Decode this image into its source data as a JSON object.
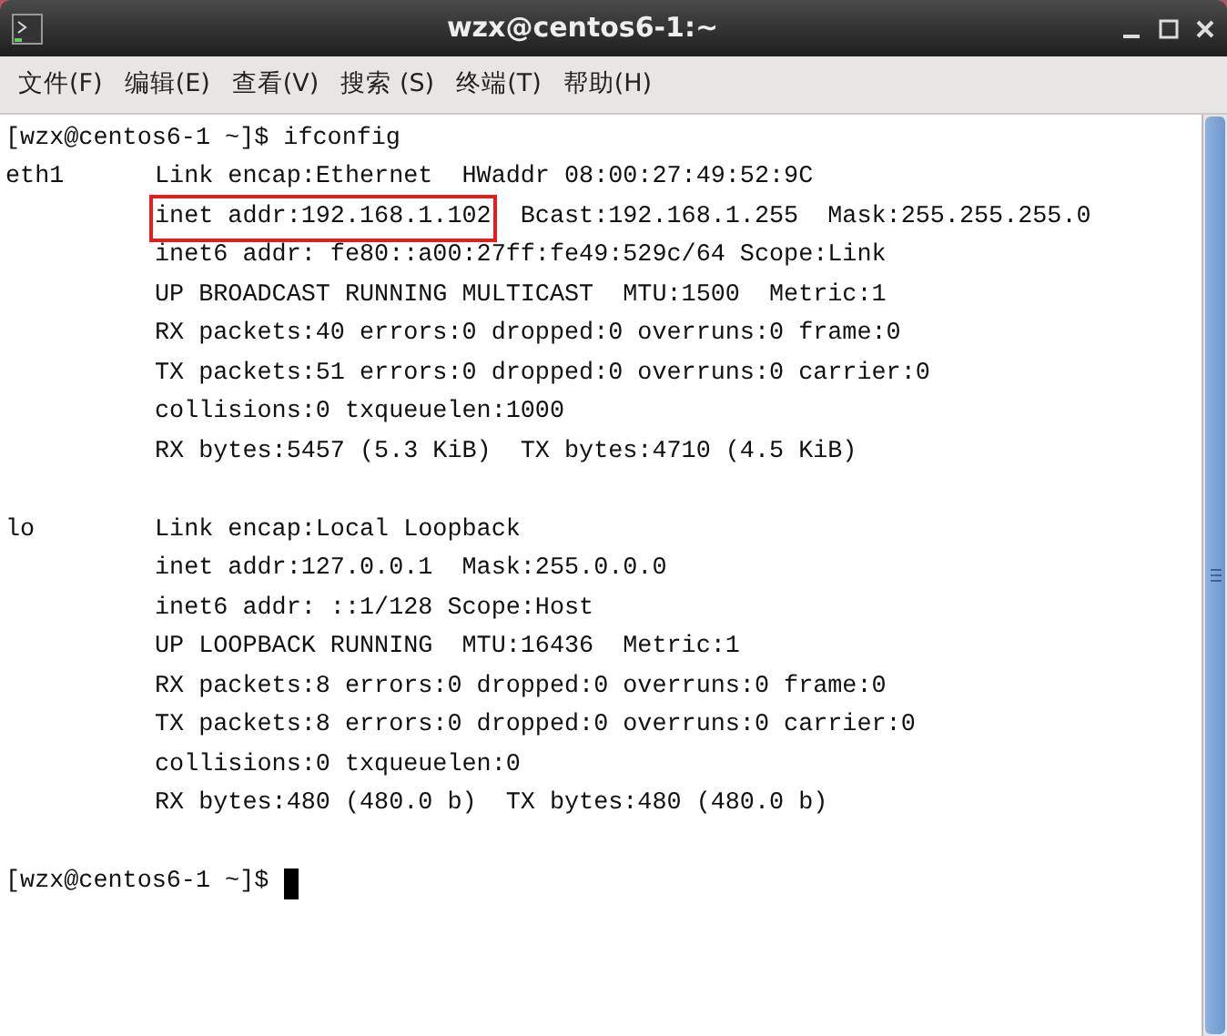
{
  "window": {
    "title": "wzx@centos6-1:~"
  },
  "menu": [
    "文件(F)",
    "编辑(E)",
    "查看(V)",
    "搜索 (S)",
    "终端(T)",
    "帮助(H)"
  ],
  "terminal": {
    "lines": [
      {
        "kind": "prompt",
        "text": "[wzx@centos6-1 ~]$ ifconfig",
        "cursor": false
      },
      {
        "kind": "field",
        "iface": "eth1",
        "parts": [
          {
            "text": "Link encap:Ethernet  HWaddr 08:00:27:49:52:9C",
            "highlighted": false
          }
        ]
      },
      {
        "kind": "field",
        "parts": [
          {
            "text": "inet addr:192.168.1.102",
            "highlighted": true
          },
          {
            "text": "  Bcast:192.168.1.255  Mask:255.255.255.0",
            "highlighted": false
          }
        ]
      },
      {
        "kind": "field",
        "parts": [
          {
            "text": "inet6 addr: fe80::a00:27ff:fe49:529c/64 Scope:Link",
            "highlighted": false
          }
        ]
      },
      {
        "kind": "field",
        "parts": [
          {
            "text": "UP BROADCAST RUNNING MULTICAST  MTU:1500  Metric:1",
            "highlighted": false
          }
        ]
      },
      {
        "kind": "field",
        "parts": [
          {
            "text": "RX packets:40 errors:0 dropped:0 overruns:0 frame:0",
            "highlighted": false
          }
        ]
      },
      {
        "kind": "field",
        "parts": [
          {
            "text": "TX packets:51 errors:0 dropped:0 overruns:0 carrier:0",
            "highlighted": false
          }
        ]
      },
      {
        "kind": "field",
        "parts": [
          {
            "text": "collisions:0 txqueuelen:1000",
            "highlighted": false
          }
        ]
      },
      {
        "kind": "field",
        "parts": [
          {
            "text": "RX bytes:5457 (5.3 KiB)  TX bytes:4710 (4.5 KiB)",
            "highlighted": false
          }
        ]
      },
      {
        "kind": "blank"
      },
      {
        "kind": "field",
        "iface": "lo",
        "parts": [
          {
            "text": "Link encap:Local Loopback",
            "highlighted": false
          }
        ]
      },
      {
        "kind": "field",
        "parts": [
          {
            "text": "inet addr:127.0.0.1  Mask:255.0.0.0",
            "highlighted": false
          }
        ]
      },
      {
        "kind": "field",
        "parts": [
          {
            "text": "inet6 addr: ::1/128 Scope:Host",
            "highlighted": false
          }
        ]
      },
      {
        "kind": "field",
        "parts": [
          {
            "text": "UP LOOPBACK RUNNING  MTU:16436  Metric:1",
            "highlighted": false
          }
        ]
      },
      {
        "kind": "field",
        "parts": [
          {
            "text": "RX packets:8 errors:0 dropped:0 overruns:0 frame:0",
            "highlighted": false
          }
        ]
      },
      {
        "kind": "field",
        "parts": [
          {
            "text": "TX packets:8 errors:0 dropped:0 overruns:0 carrier:0",
            "highlighted": false
          }
        ]
      },
      {
        "kind": "field",
        "parts": [
          {
            "text": "collisions:0 txqueuelen:0",
            "highlighted": false
          }
        ]
      },
      {
        "kind": "field",
        "parts": [
          {
            "text": "RX bytes:480 (480.0 b)  TX bytes:480 (480.0 b)",
            "highlighted": false
          }
        ]
      },
      {
        "kind": "blank"
      },
      {
        "kind": "prompt",
        "text": "[wzx@centos6-1 ~]$",
        "cursor": true
      }
    ]
  }
}
